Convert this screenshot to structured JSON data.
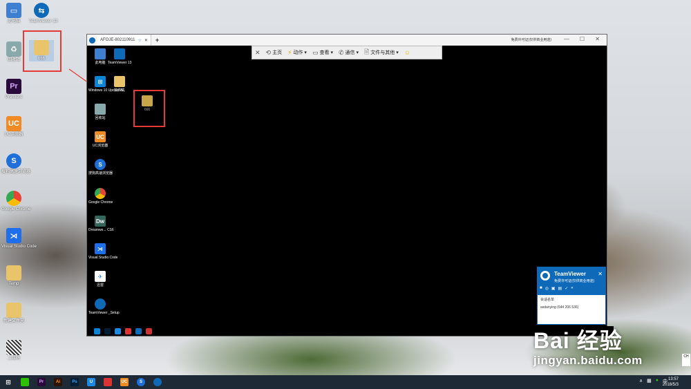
{
  "desktop": {
    "icons": [
      {
        "label": "此电脑",
        "icon": "computer-icon",
        "color": "#3f7fd1"
      },
      {
        "label": "TeamViewer 13",
        "icon": "teamviewer-icon",
        "color": "#0e6ab8"
      },
      {
        "label": "666",
        "icon": "folder-icon",
        "color": "#e9c46a"
      },
      {
        "label": "回收站",
        "icon": "recycle-bin-icon",
        "color": "#8aa"
      },
      {
        "label": "Premiere",
        "icon": "premiere-icon",
        "color": "#2a0a3a"
      },
      {
        "label": "UC浏览器",
        "icon": "uc-icon",
        "color": "#f08a24"
      },
      {
        "label": "搜狗高速浏览器",
        "icon": "sogou-icon",
        "color": "#1e6fd9"
      },
      {
        "label": "Google Chrome",
        "icon": "chrome-icon",
        "color": "#2f9e44"
      },
      {
        "label": "Visual Studio Code",
        "icon": "vscode-icon",
        "color": "#1f6feb"
      },
      {
        "label": "Temp",
        "icon": "folder-icon",
        "color": "#e9c46a"
      },
      {
        "label": "新建文件夹",
        "icon": "folder-icon",
        "color": "#e9c46a"
      },
      {
        "label": "二维码",
        "icon": "qrcode-icon",
        "color": "#444"
      }
    ]
  },
  "remote_window": {
    "tab_title": "AFOJE-802110911",
    "title_right": "免费许可证(仅供商业用途)",
    "toolbar": {
      "home": "主页",
      "actions": "动作",
      "view": "查看",
      "comm": "通信",
      "files": "文件与其他"
    },
    "icons": [
      {
        "label": "此电脑",
        "icon": "computer-icon",
        "color": "#3f7fd1"
      },
      {
        "label": "TeamViewer 13",
        "icon": "teamviewer-icon",
        "color": "#0e6ab8"
      },
      {
        "label": "Windows 10 Update A...",
        "icon": "windows-icon",
        "color": "#0a84d6"
      },
      {
        "label": "文件夹",
        "icon": "folder-icon",
        "color": "#e9c46a"
      },
      {
        "label": "回收站",
        "icon": "recycle-bin-icon",
        "color": "#8aa"
      },
      {
        "label": "666",
        "icon": "folder-icon",
        "color": "#c9a54a"
      },
      {
        "label": "UC浏览器",
        "icon": "uc-icon",
        "color": "#f08a24"
      },
      {
        "label": "搜狗高速浏览器",
        "icon": "sogou-icon",
        "color": "#1e6fd9"
      },
      {
        "label": "Google Chrome",
        "icon": "chrome-icon",
        "color": "#2f9e44"
      },
      {
        "label": "Dreamwe... CS6",
        "icon": "dreamweaver-icon",
        "color": "#35655b"
      },
      {
        "label": "Visual Studio Code",
        "icon": "vscode-icon",
        "color": "#1f6feb"
      },
      {
        "label": "迅雷",
        "icon": "thunder-icon",
        "color": "#1e88e5"
      },
      {
        "label": "TeamViewer _Setup",
        "icon": "teamviewer-icon",
        "color": "#0e6ab8"
      }
    ]
  },
  "tv_panel": {
    "name": "TeamViewer",
    "subtitle": "免费许可证(仅供商业用途)",
    "session_header": "会话名单",
    "session_entry": "asdanying (644 206 536)"
  },
  "taskbar": {
    "time": "13:57",
    "date": "2018/5/3",
    "lang": "中",
    "ch": "CH"
  },
  "watermark": {
    "brand": "Bai 经验",
    "url": "jingyan.baidu.com"
  },
  "colors": {
    "tv_blue": "#0e6ab8",
    "highlight_red": "#e53935"
  }
}
